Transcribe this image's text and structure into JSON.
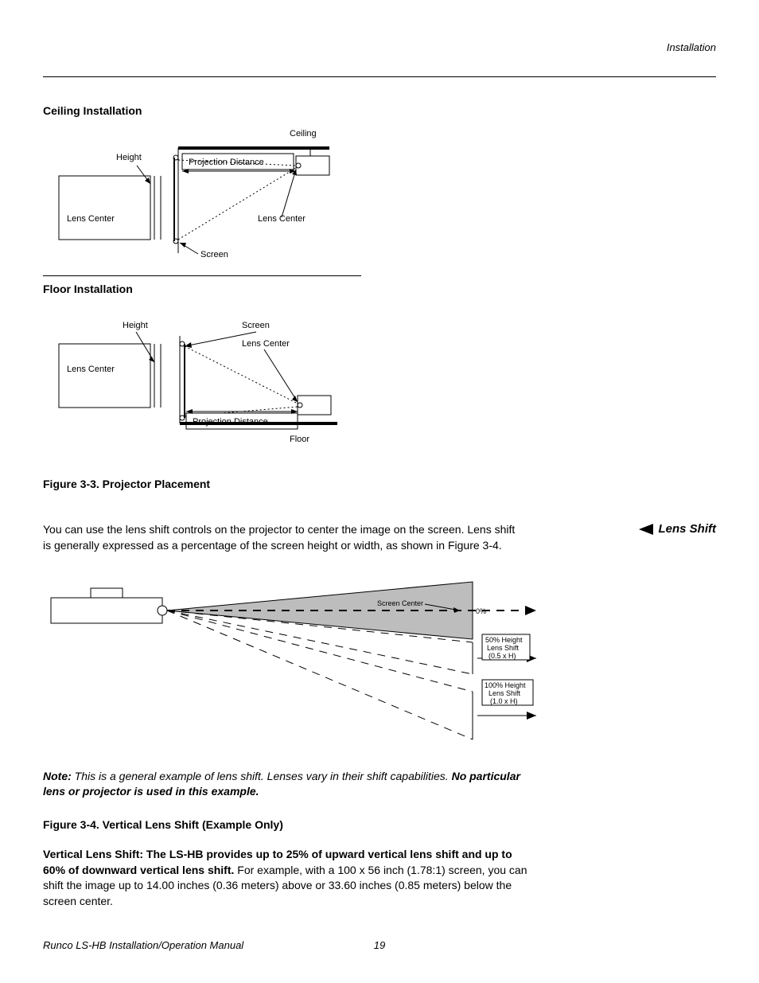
{
  "header": {
    "section": "Installation"
  },
  "fig33": {
    "ceiling_title": "Ceiling Installation",
    "floor_title": "Floor Installation",
    "labels": {
      "ceiling": "Ceiling",
      "floor": "Floor",
      "height": "Height",
      "projection_distance": "Projection Distance",
      "lens_center": "Lens Center",
      "screen": "Screen"
    },
    "caption": "Figure 3-3. Projector Placement"
  },
  "lens_shift": {
    "side_label": "Lens Shift",
    "para": "You can use the lens shift controls on the projector to center the image on the screen. Lens shift is generally expressed as a percentage of the screen height or width, as shown in Figure 3-4."
  },
  "fig34": {
    "labels": {
      "screen_center": "Screen Center",
      "zero_pct": "0%",
      "fifty_line1": "50% Height",
      "fifty_line2": "Lens Shift",
      "fifty_line3": "(0.5 x H)",
      "hundred_line1": "100% Height",
      "hundred_line2": "Lens Shift",
      "hundred_line3": "(1.0 x H)"
    },
    "note": {
      "label": "Note:",
      "text1": " This is a general example of lens shift. Lenses vary in their shift capabilities. ",
      "bold": "No particular lens or projector is used in this example.",
      "text2": ""
    },
    "caption": "Figure 3-4. Vertical Lens Shift (Example Only)"
  },
  "vls": {
    "bold": "Vertical Lens Shift: The LS-HB provides up to 25% of upward vertical lens shift and up to 60% of downward vertical lens shift.",
    "rest": " For example, with a 100 x 56 inch (1.78:1) screen, you can shift the image up to 14.00 inches (0.36 meters) above or 33.60 inches (0.85 meters) below the screen center."
  },
  "footer": {
    "manual": "Runco LS-HB Installation/Operation Manual",
    "page": "19"
  }
}
